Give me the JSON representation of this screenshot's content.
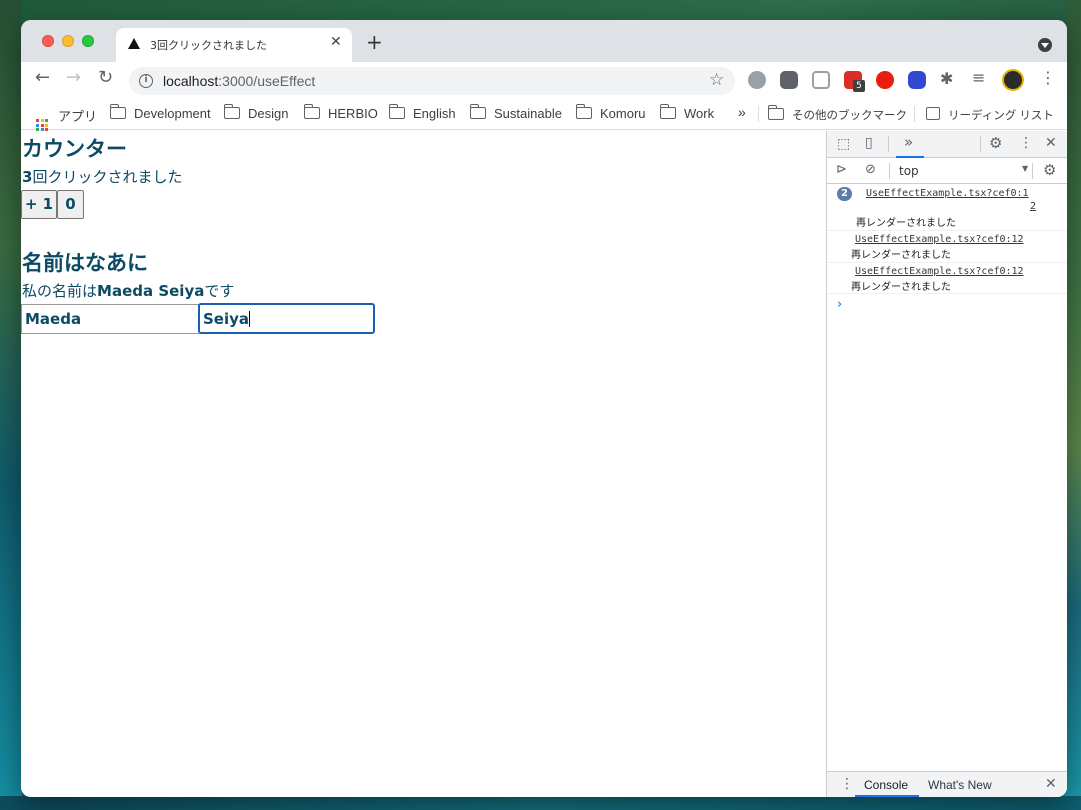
{
  "browser": {
    "tab_title": "3回クリックされました",
    "url_host": "localhost",
    "url_rest": ":3000/useEffect",
    "extension_badge": "5"
  },
  "bookmarks": [
    {
      "label": "アプリ",
      "type": "apps"
    },
    {
      "label": "Development",
      "type": "folder"
    },
    {
      "label": "Design",
      "type": "folder"
    },
    {
      "label": "HERBIO",
      "type": "folder"
    },
    {
      "label": "English",
      "type": "folder"
    },
    {
      "label": "Sustainable",
      "type": "folder"
    },
    {
      "label": "Komoru",
      "type": "folder"
    },
    {
      "label": "Work",
      "type": "folder"
    }
  ],
  "bookmarks_overflow": "»",
  "other_bookmarks": "その他のブックマーク",
  "reading_list": "リーディング リスト",
  "page": {
    "counter": {
      "heading": "カウンター",
      "count": "3",
      "message_suffix": "回クリックされました",
      "increment_label": "+ 1",
      "reset_label": "0"
    },
    "name": {
      "heading": "名前はなあに",
      "prefix": "私の名前は",
      "full_name": "Maeda Seiya",
      "suffix": "です",
      "last_name_value": "Maeda",
      "first_name_value": "Seiya"
    }
  },
  "devtools": {
    "context": "top",
    "logs": [
      {
        "count": "2",
        "source_line1": "UseEffectExample.tsx?cef0:1",
        "source_line2": "2",
        "message": "再レンダーされました"
      },
      {
        "source": "UseEffectExample.tsx?cef0:12",
        "message": "再レンダーされました"
      },
      {
        "source": "UseEffectExample.tsx?cef0:12",
        "message": "再レンダーされました"
      }
    ],
    "prompt": "›",
    "drawer_tabs": [
      "Console",
      "What's New"
    ]
  }
}
